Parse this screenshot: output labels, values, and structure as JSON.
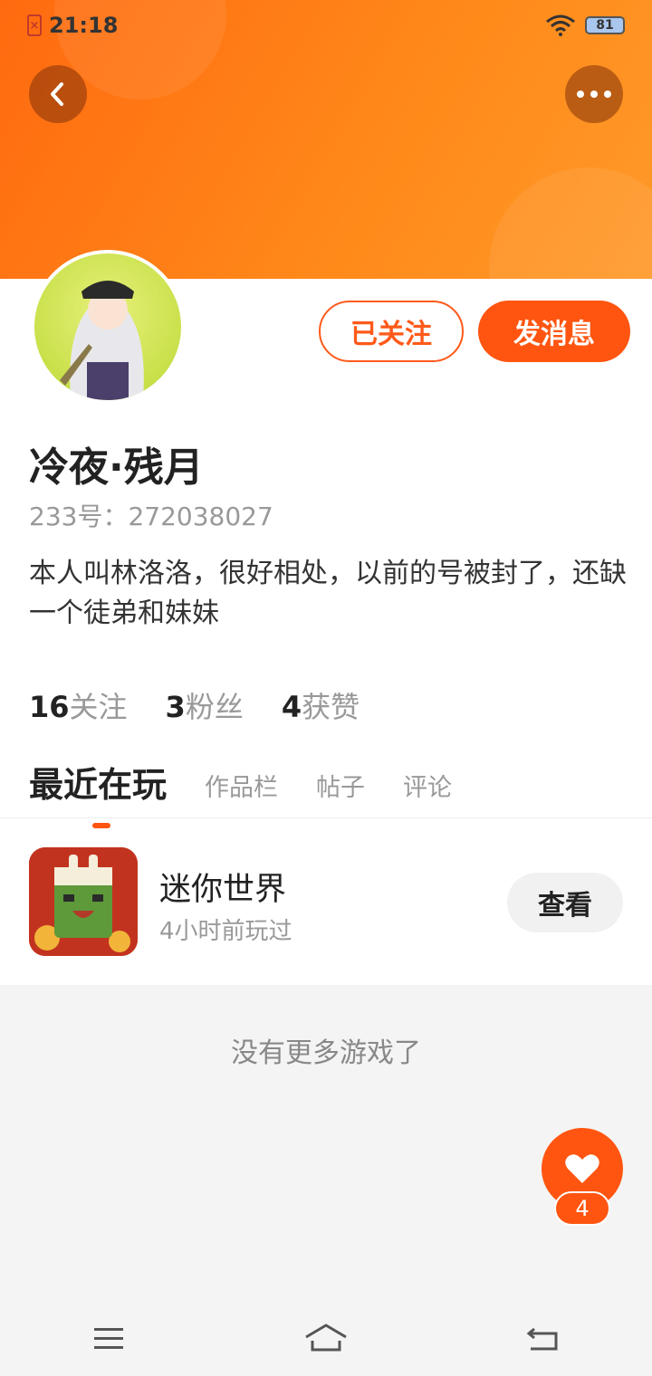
{
  "status_bar": {
    "time": "21:18",
    "battery": "81"
  },
  "profile": {
    "name": "冷夜·残月",
    "id_line": "233号：272038027",
    "bio": "本人叫林洛洛，很好相处，以前的号被封了，还缺一个徒弟和妹妹",
    "follow_button": "已关注",
    "message_button": "发消息"
  },
  "stats": [
    {
      "count": "16",
      "label": "关注"
    },
    {
      "count": "3",
      "label": "粉丝"
    },
    {
      "count": "4",
      "label": "获赞"
    }
  ],
  "tabs": [
    {
      "label": "最近在玩",
      "active": true
    },
    {
      "label": "作品栏",
      "active": false
    },
    {
      "label": "帖子",
      "active": false
    },
    {
      "label": "评论",
      "active": false
    }
  ],
  "recent_game": {
    "name": "迷你世界",
    "played": "4小时前玩过",
    "view_button": "查看"
  },
  "empty_message": "没有更多游戏了",
  "like_count": "4",
  "colors": {
    "accent": "#ff5510",
    "header": "#ff7a15"
  },
  "icons": [
    "back-icon",
    "more-icon",
    "heart-icon",
    "menu-icon",
    "home-icon",
    "return-icon",
    "wifi-icon",
    "battery-icon"
  ]
}
